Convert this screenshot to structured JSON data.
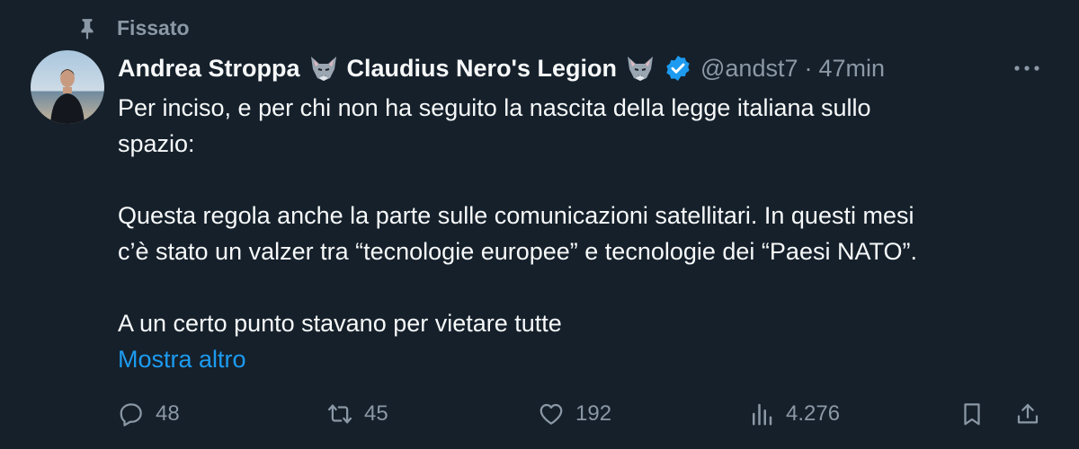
{
  "pinned_label": "Fissato",
  "author": {
    "name": "Andrea Stroppa",
    "secondary_name": "Claudius Nero's Legion",
    "handle": "@andst7",
    "separator": "·",
    "time": "47min",
    "verified": true
  },
  "tweet": {
    "lines": [
      "Per inciso, e per chi non ha seguito la nascita della legge italiana sullo",
      "spazio:",
      "",
      "Questa regola anche la parte sulle comunicazioni satellitari. In questi mesi",
      "c’è stato un valzer tra “tecnologie europee” e tecnologie dei “Paesi NATO”.",
      "",
      "A un certo punto stavano per vietare tutte"
    ],
    "show_more": "Mostra altro"
  },
  "actions": {
    "replies": "48",
    "reposts": "45",
    "likes": "192",
    "views": "4.276"
  },
  "colors": {
    "background": "#15202b",
    "text": "#f7f9f9",
    "secondary": "#8b98a5",
    "accent": "#1d9bf0"
  },
  "icons": [
    "pin-icon",
    "wolf-emoji-icon",
    "verified-badge-icon",
    "more-icon",
    "reply-icon",
    "repost-icon",
    "like-icon",
    "views-icon",
    "bookmark-icon",
    "share-icon"
  ]
}
